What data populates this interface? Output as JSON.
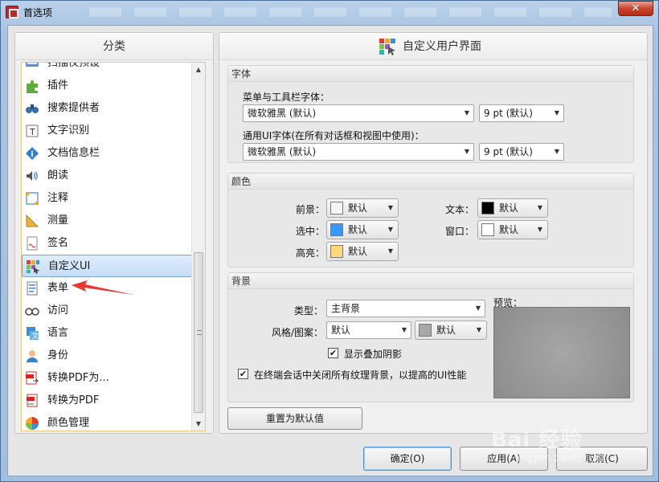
{
  "window": {
    "title": "首选项",
    "close_label": "✕"
  },
  "left": {
    "header": "分类",
    "items": [
      {
        "label": "扫描仪预设",
        "icon": "scanner-icon"
      },
      {
        "label": "插件",
        "icon": "puzzle-icon"
      },
      {
        "label": "搜索提供者",
        "icon": "binoculars-icon"
      },
      {
        "label": "文字识别",
        "icon": "ocr-icon"
      },
      {
        "label": "文档信息栏",
        "icon": "info-icon"
      },
      {
        "label": "朗读",
        "icon": "speaker-icon"
      },
      {
        "label": "注释",
        "icon": "comment-icon"
      },
      {
        "label": "测量",
        "icon": "ruler-icon"
      },
      {
        "label": "签名",
        "icon": "signature-icon"
      },
      {
        "label": "自定义UI",
        "icon": "customize-ui-icon",
        "selected": true
      },
      {
        "label": "表单",
        "icon": "form-icon"
      },
      {
        "label": "访问",
        "icon": "glasses-icon"
      },
      {
        "label": "语言",
        "icon": "language-icon"
      },
      {
        "label": "身份",
        "icon": "user-icon"
      },
      {
        "label": "转换PDF为...",
        "icon": "pdf-convert-icon"
      },
      {
        "label": "转换为PDF",
        "icon": "to-pdf-icon"
      },
      {
        "label": "颜色管理",
        "icon": "color-wheel-icon"
      }
    ]
  },
  "right": {
    "header": "自定义用户界面",
    "font_group": {
      "title": "字体",
      "menu_toolbar_label": "菜单与工具栏字体：",
      "menu_font_value": "微软雅黑 (默认)",
      "menu_size_value": "9 pt (默认)",
      "ui_label": "通用UI字体(在所有对话框和视图中使用)：",
      "ui_font_value": "微软雅黑 (默认)",
      "ui_size_value": "9 pt (默认)"
    },
    "color_group": {
      "title": "颜色",
      "foreground_label": "前景：",
      "foreground_value": "默认",
      "foreground_color": "#f5f5f5",
      "selection_label": "选中：",
      "selection_value": "默认",
      "selection_color": "#3399ff",
      "highlight_label": "高亮：",
      "highlight_value": "默认",
      "highlight_color": "#ffd97a",
      "text_label": "文本：",
      "text_value": "默认",
      "text_color": "#000000",
      "window_label": "窗口：",
      "window_value": "默认",
      "window_color": "#ffffff"
    },
    "background_group": {
      "title": "背景",
      "type_label": "类型：",
      "type_value": "主背景",
      "style_label": "风格/图案：",
      "style_value": "默认",
      "swatch_value": "默认",
      "swatch_color": "#a8a8a8",
      "preview_label": "预览：",
      "drop_shadow_label": "显示叠加阴影",
      "drop_shadow_checked": true,
      "disable_texture_label": "在终端会话中关闭所有纹理背景，以提高的UI性能",
      "disable_texture_checked": true
    },
    "reset_button": "重置为默认值"
  },
  "footer": {
    "ok_button": "确定(O)",
    "apply_button": "应用(A)",
    "cancel_button": "取消(C)"
  },
  "watermark": {
    "text": "Bai 经验",
    "sub": "jingyan.baidu.com"
  }
}
